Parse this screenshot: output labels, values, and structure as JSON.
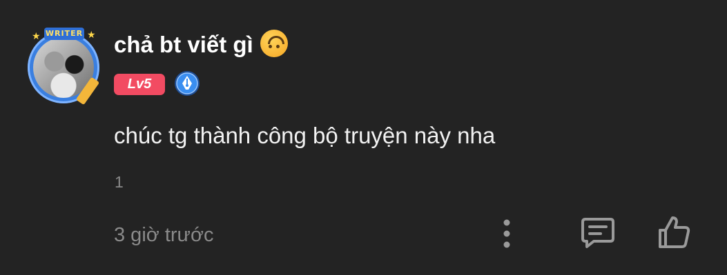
{
  "comment": {
    "avatar": {
      "banner_text": "WRITER",
      "icon": "writer-frame-avatar"
    },
    "username": "chả bt viết gì",
    "username_emoji": "upside-down-face-icon",
    "level_badge": "Lv5",
    "badge_icon": "fountain-pen-badge-icon",
    "text": "chúc tg thành công bộ truyện này nha",
    "reply_count": "1",
    "timestamp": "3 giờ trước",
    "actions": {
      "more_icon": "more-vertical-icon",
      "reply_icon": "comment-icon",
      "like_icon": "thumbs-up-icon"
    },
    "colors": {
      "background": "#232323",
      "level_badge": "#f24b62",
      "pen_badge": "#3a8ef0",
      "muted_text": "#8a8a8a"
    }
  }
}
